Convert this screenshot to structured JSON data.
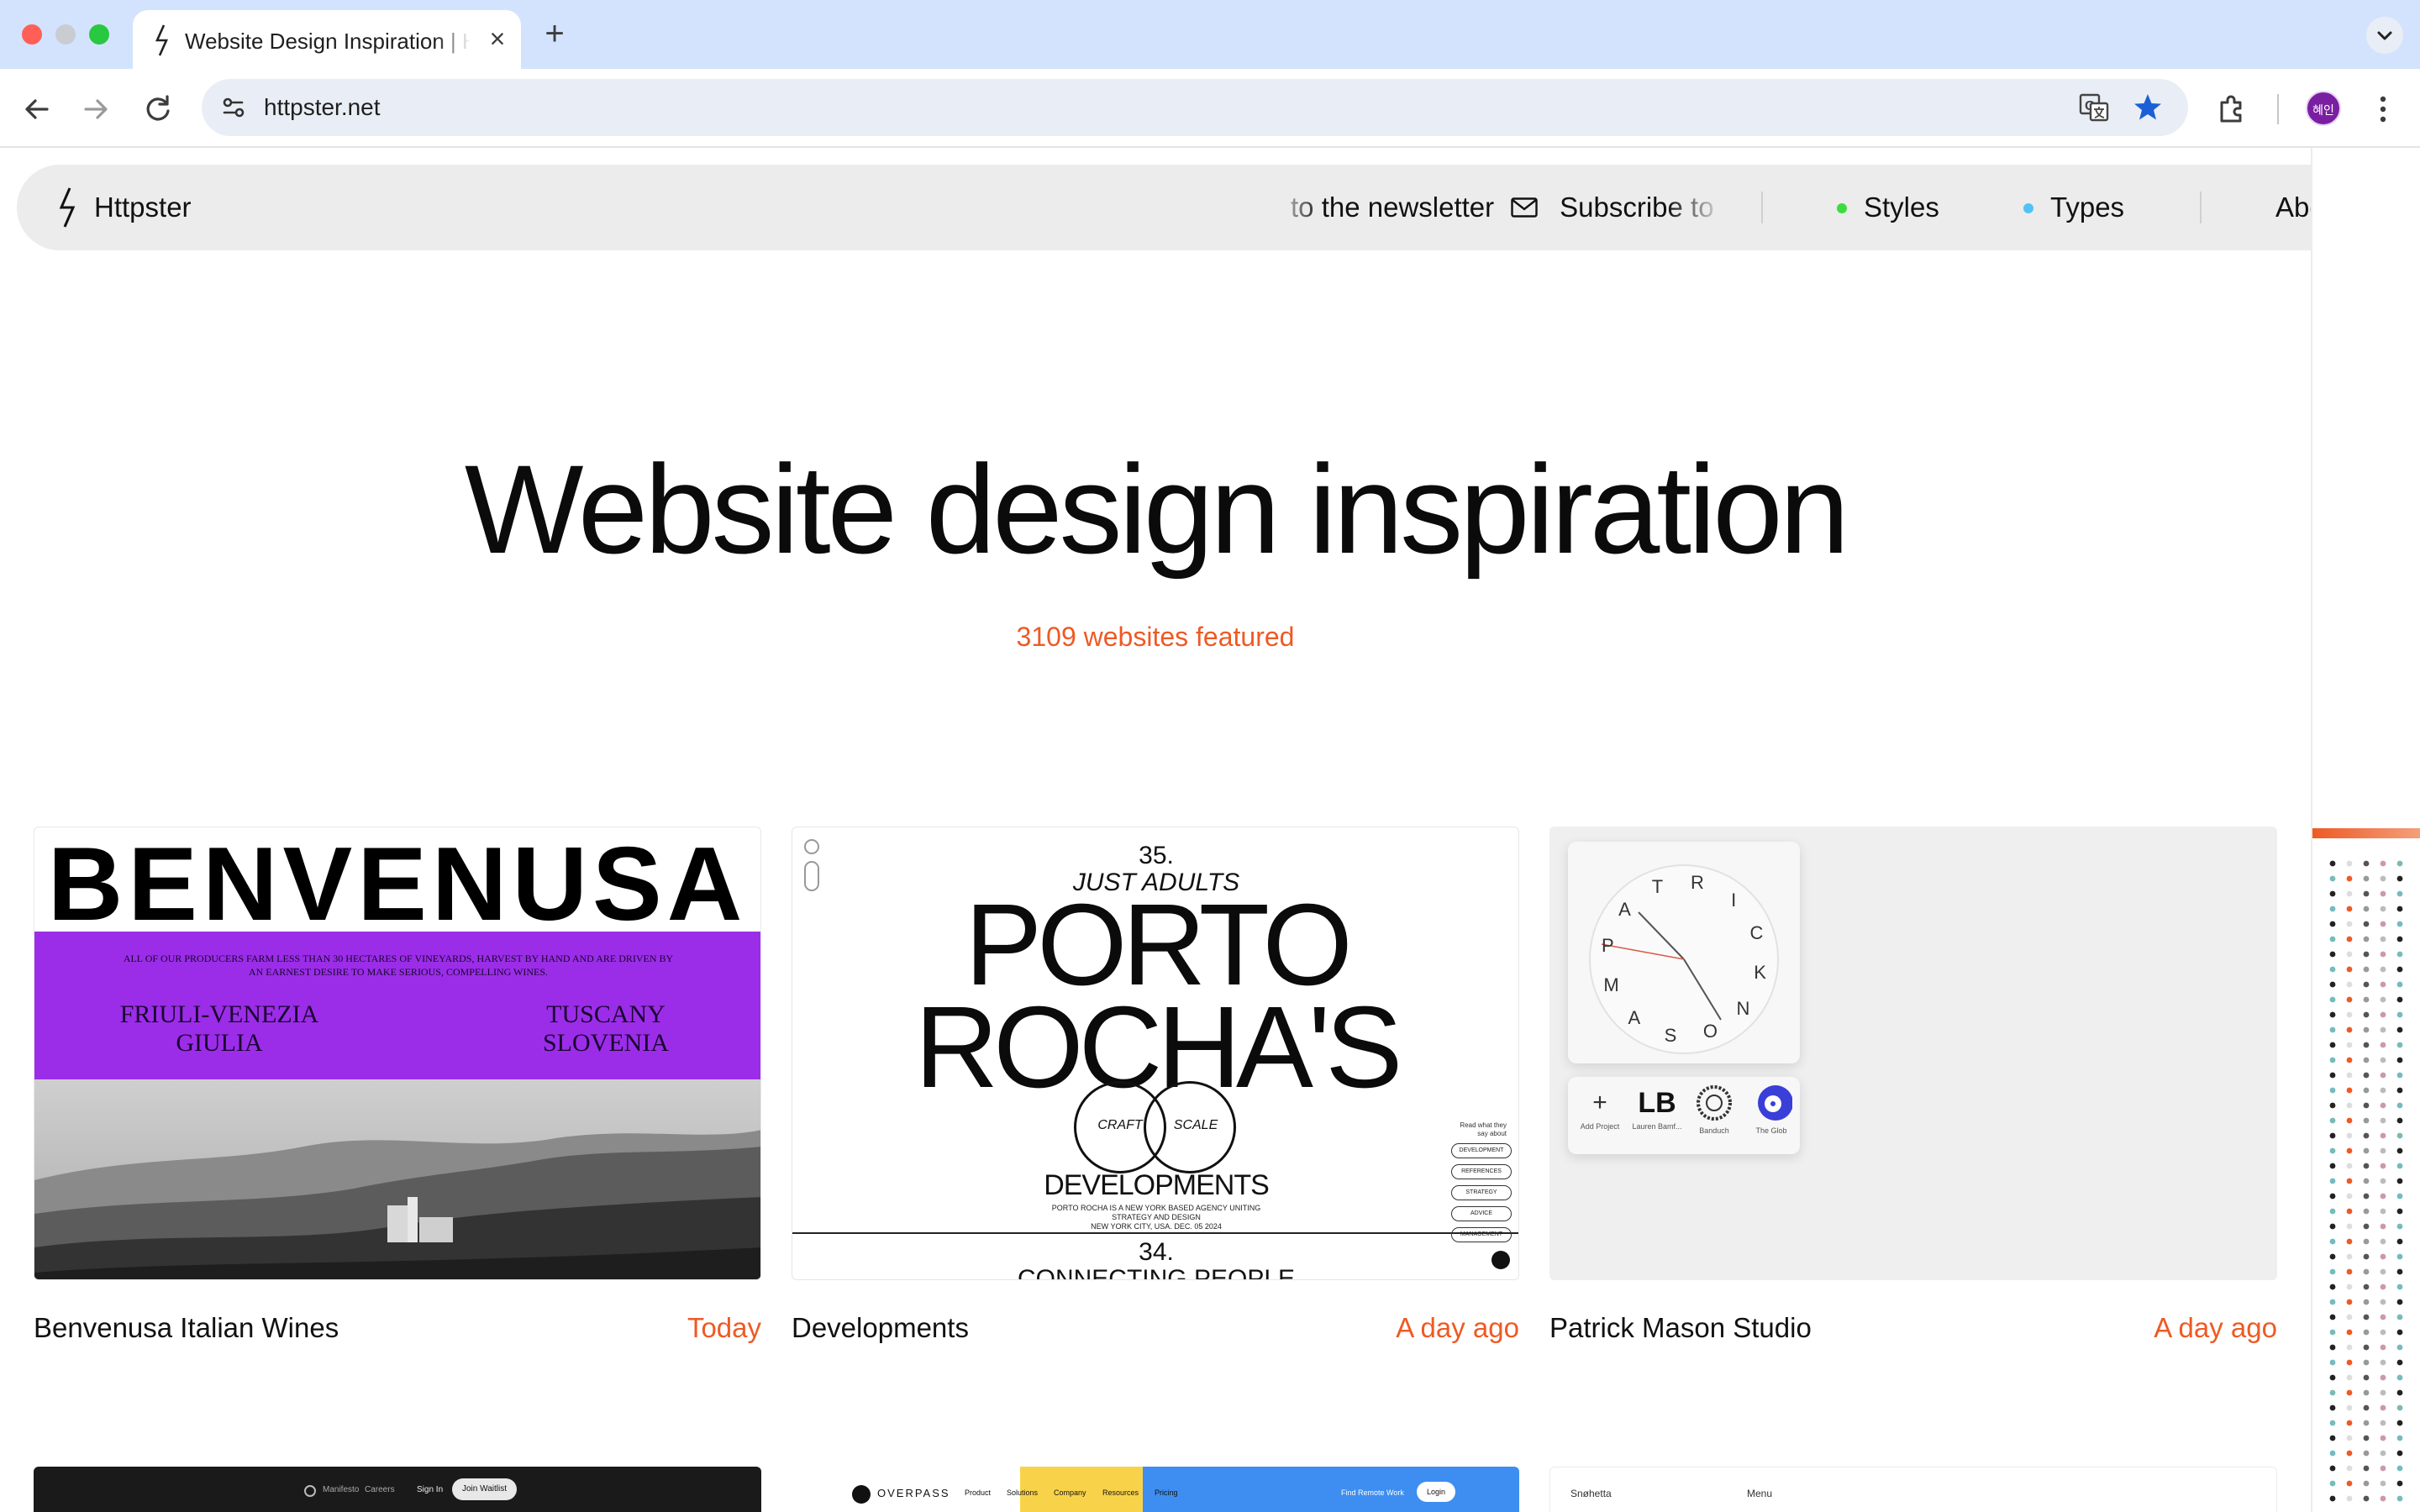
{
  "browser": {
    "tab_title": "Website Design Inspiration | Httpster",
    "url": "httpster.net",
    "profile_initials": "혜인"
  },
  "site": {
    "logo_text": "Httpster",
    "ticker_text_a": "to the newsletter",
    "ticker_text_b": "Subscribe to",
    "nav": {
      "styles": "Styles",
      "types": "Types",
      "about": "About"
    },
    "colors": {
      "styles_dot": "#3ddc3d",
      "types_dot": "#4fc3f7",
      "accent": "#ee5a24"
    }
  },
  "hero": {
    "title": "Website design inspiration",
    "count": "3109 websites featured"
  },
  "cards": [
    {
      "name": "Benvenusa Italian Wines",
      "time": "Today",
      "thumb": {
        "headline": "BENVENUSA",
        "tagline": "ALL OF OUR PRODUCERS FARM LESS THAN 30 HECTARES OF VINEYARDS, HARVEST BY HAND AND ARE DRIVEN BY AN EARNEST DESIRE TO MAKE SERIOUS, COMPELLING WINES.",
        "region_1a": "FRIULI-VENEZIA",
        "region_1b": "GIULIA",
        "region_2a": "TUSCANY",
        "region_2b": "SLOVENIA"
      }
    },
    {
      "name": "Developments",
      "time": "A day ago",
      "thumb": {
        "num_top": "35.",
        "kicker": "JUST ADULTS",
        "line1": "PORTO",
        "line2": "ROCHA'S",
        "circle_a": "CRAFT",
        "circle_b": "SCALE",
        "line3": "DEVELOPMENTS",
        "small1": "PORTO ROCHA IS A NEW YORK BASED AGENCY UNITING",
        "small2": "STRATEGY AND DESIGN",
        "small3": "NEW YORK CITY, USA. DEC. 05 2024",
        "num_bottom": "34.",
        "next": "CONNECTING PEOPLE",
        "side_note": "Read what they say about",
        "pills": [
          "DEVELOPMENT",
          "REFERENCES",
          "STRATEGY",
          "ADVICE",
          "MANAGEMENT"
        ]
      }
    },
    {
      "name": "Patrick Mason Studio",
      "time": "A day ago",
      "thumb": {
        "letters": [
          "R",
          "I",
          "C",
          "K",
          "N",
          "O",
          "S",
          "A",
          "M",
          "P",
          "A",
          "T"
        ],
        "tiles": [
          {
            "label": "Add Project",
            "glyph": "+"
          },
          {
            "label": "Lauren Bamf...",
            "glyph": "LB"
          },
          {
            "label": "Banduch",
            "glyph": ""
          },
          {
            "label": "The Glob",
            "glyph": ""
          }
        ]
      }
    }
  ],
  "row2": {
    "c1": {
      "a": "Manifesto",
      "b": "Careers",
      "c": "Sign In",
      "d": "Join Waitlist"
    },
    "c2": {
      "brand": "OVERPASS",
      "m1": "Product",
      "m2": "Solutions",
      "m3": "Company",
      "m4": "Resources",
      "m5": "Pricing",
      "cta": "Find Remote Work",
      "login": "Login"
    },
    "c3": {
      "brand": "Snøhetta",
      "menu": "Menu"
    }
  }
}
